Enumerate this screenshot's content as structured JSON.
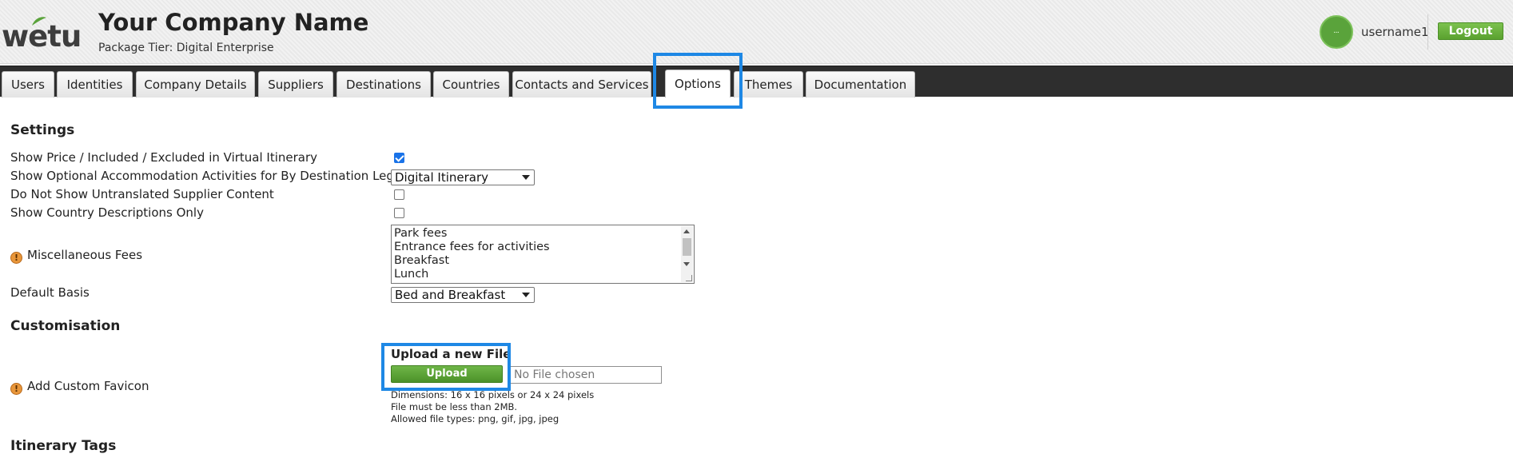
{
  "header": {
    "logo_text": "wetu",
    "company_name": "Your Company Name",
    "package_tier": "Package Tier: Digital Enterprise",
    "username": "username1",
    "logout_label": "Logout"
  },
  "tabs": [
    {
      "label": "Users"
    },
    {
      "label": "Identities"
    },
    {
      "label": "Company Details"
    },
    {
      "label": "Suppliers"
    },
    {
      "label": "Destinations"
    },
    {
      "label": "Countries"
    },
    {
      "label": "Contacts and Services"
    },
    {
      "label": "Options",
      "active": true
    },
    {
      "label": "Themes"
    },
    {
      "label": "Documentation"
    }
  ],
  "settings": {
    "title": "Settings",
    "show_price_label": "Show Price / Included / Excluded in Virtual Itinerary",
    "show_price_checked": true,
    "show_optional_label": "Show Optional Accommodation Activities for By Destination Legs",
    "show_optional_value": "Digital Itinerary",
    "untranslated_label": "Do Not Show Untranslated Supplier Content",
    "untranslated_checked": false,
    "country_desc_label": "Show Country Descriptions Only",
    "country_desc_checked": false,
    "misc_fees_label": "Miscellaneous Fees",
    "misc_fees_items": [
      "Park fees",
      "Entrance fees for activities",
      "Breakfast",
      "Lunch"
    ],
    "default_basis_label": "Default Basis",
    "default_basis_value": "Bed and Breakfast"
  },
  "customisation": {
    "title": "Customisation",
    "favicon_label": "Add Custom Favicon",
    "upload_title": "Upload a new File",
    "upload_button": "Upload",
    "file_placeholder": "No File chosen",
    "dimensions_note": "Dimensions: 16 x 16 pixels or 24 x 24 pixels",
    "size_note": "File must be less than 2MB.",
    "types_note": "Allowed file types: png, gif, jpg, jpeg"
  },
  "itinerary_tags": {
    "title": "Itinerary Tags"
  },
  "colors": {
    "accent_green": "#5aa12f",
    "highlight_blue": "#1e88e5",
    "tabbar_dark": "#2e2e2e",
    "warning_orange": "#e8963a"
  }
}
